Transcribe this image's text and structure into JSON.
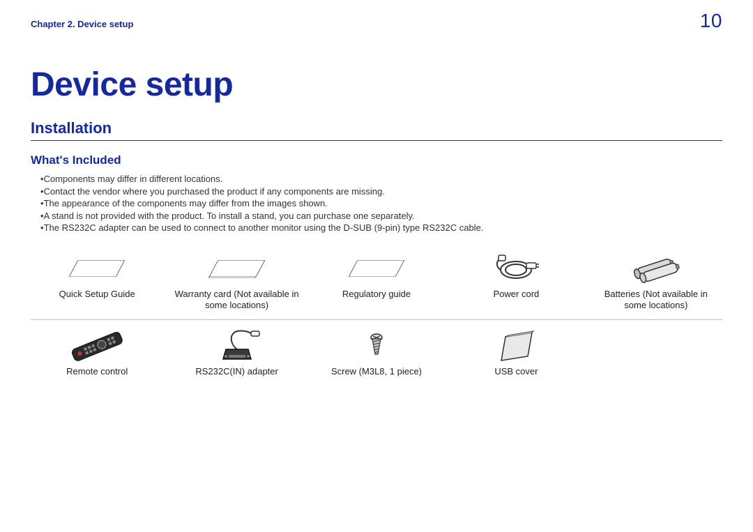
{
  "header": {
    "chapter_label": "Chapter 2. Device setup",
    "page_number": "10"
  },
  "chapter_title": "Device setup",
  "section_title": "Installation",
  "subsection_title": "What's Included",
  "bullets": [
    "Components may differ in different locations.",
    "Contact the vendor where you purchased the product if any components are missing.",
    "The appearance of the components may differ from the images shown.",
    "A stand is not provided with the product. To install a stand, you can purchase one separately.",
    "The RS232C adapter can be used to connect to another monitor using the D-SUB (9-pin) type RS232C cable."
  ],
  "items_row1": [
    {
      "label": "Quick Setup Guide"
    },
    {
      "label": "Warranty card (Not available in some locations)"
    },
    {
      "label": "Regulatory guide"
    },
    {
      "label": "Power cord"
    },
    {
      "label": "Batteries (Not available in some locations)"
    }
  ],
  "items_row2": [
    {
      "label": "Remote control"
    },
    {
      "label": "RS232C(IN) adapter"
    },
    {
      "label": "Screw (M3L8, 1 piece)"
    },
    {
      "label": "USB cover"
    }
  ]
}
